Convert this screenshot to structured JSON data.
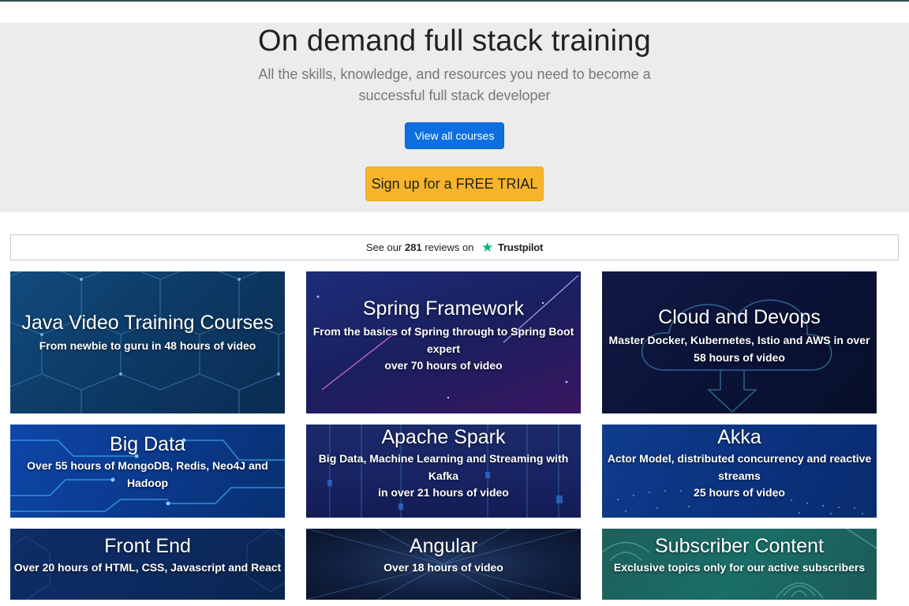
{
  "hero": {
    "title": "On demand full stack training",
    "subtitle": "All the skills, knowledge, and resources you need to become a successful full stack developer",
    "view_all_label": "View all courses",
    "trial_label": "Sign up for a FREE TRIAL"
  },
  "trustpilot": {
    "prefix": "See our",
    "count": "281",
    "suffix": "reviews on",
    "brand": "Trustpilot"
  },
  "courses": [
    {
      "title": "Java Video Training Courses",
      "description": "From newbie to guru in 48 hours of video"
    },
    {
      "title": "Spring Framework",
      "description": "From the basics of Spring through to Spring Boot expert\nover 70 hours of video"
    },
    {
      "title": "Cloud and Devops",
      "description": "Master Docker, Kubernetes, Istio and AWS in over 58 hours of video"
    },
    {
      "title": "Big Data",
      "description": "Over 55 hours of MongoDB, Redis, Neo4J and Hadoop"
    },
    {
      "title": "Apache Spark",
      "description": "Big Data, Machine Learning and Streaming with Kafka\nin over 21 hours of video"
    },
    {
      "title": "Akka",
      "description": "Actor Model, distributed concurrency and reactive streams\n25 hours of video"
    },
    {
      "title": "Front End",
      "description": "Over 20 hours of HTML, CSS, Javascript and React"
    },
    {
      "title": "Angular",
      "description": "Over 18 hours of video"
    },
    {
      "title": "Subscriber Content",
      "description": "Exclusive topics only for our active subscribers"
    }
  ],
  "colors": {
    "primary_button": "#0d6fe0",
    "trial_button": "#f6b42c",
    "trustpilot_star": "#00b67a"
  }
}
